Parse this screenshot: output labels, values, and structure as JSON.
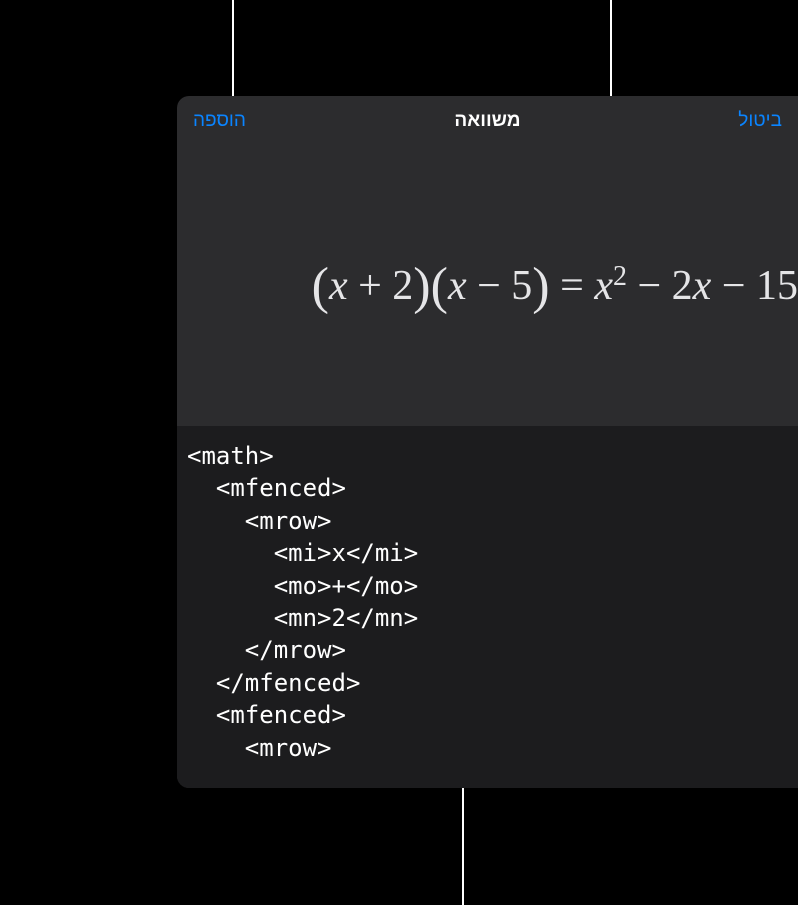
{
  "header": {
    "title": "משוואה",
    "add_label": "הוספה",
    "cancel_label": "ביטול"
  },
  "equation": {
    "lparen1": "(",
    "x1": "x",
    "plus": " + ",
    "two": "2",
    "rparen1": ")",
    "lparen2": "(",
    "x2": "x",
    "minus1": " − ",
    "five": "5",
    "rparen2": ")",
    "equals": " = ",
    "x3": "x",
    "sup2": "2",
    "minus2": " − ",
    "coef2": "2",
    "x4": "x",
    "minus3": " − ",
    "fifteen": "15"
  },
  "code": "<math>\n  <mfenced>\n    <mrow>\n      <mi>x</mi>\n      <mo>+</mo>\n      <mn>2</mn>\n    </mrow>\n  </mfenced>\n  <mfenced>\n    <mrow>"
}
